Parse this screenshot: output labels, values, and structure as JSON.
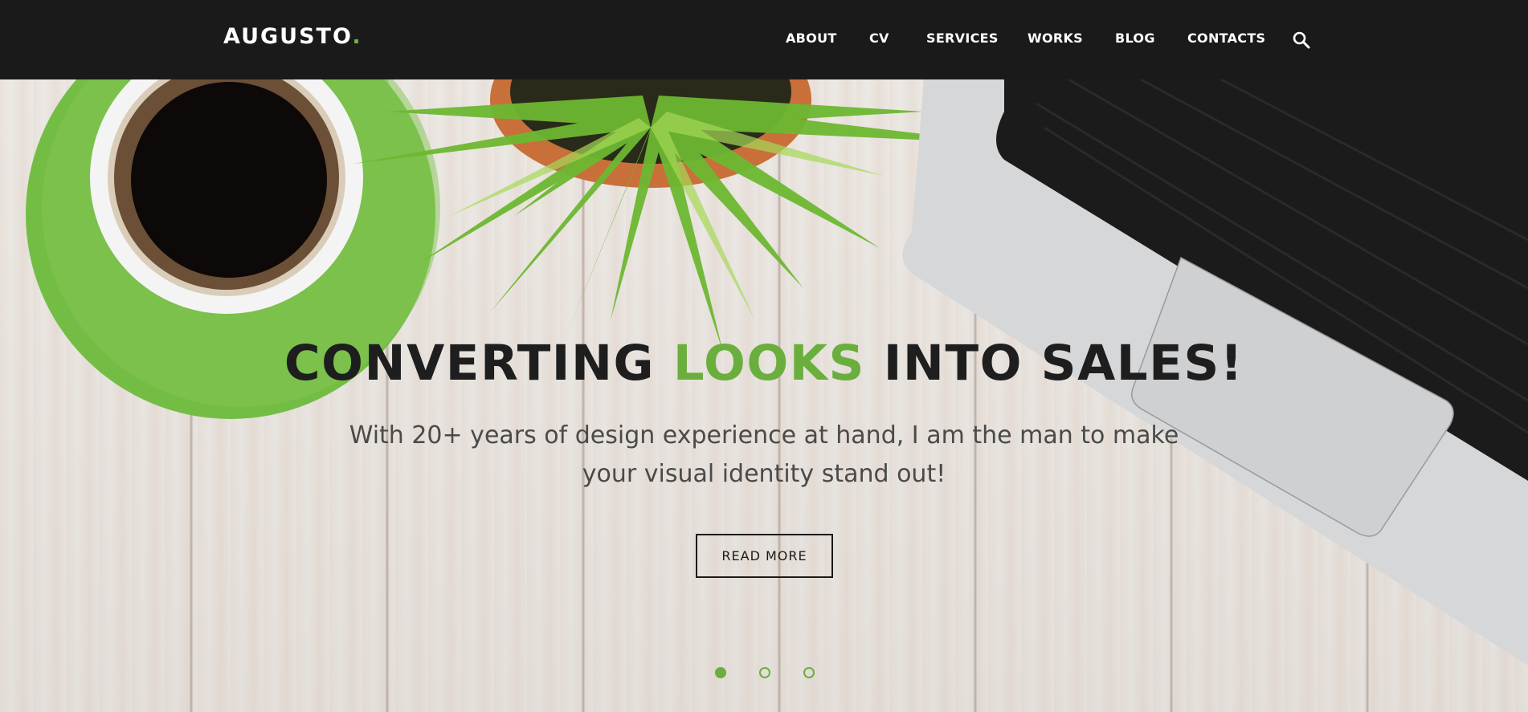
{
  "header": {
    "logo": {
      "text": "AUGUSTO",
      "dot": "."
    },
    "nav": [
      {
        "label": "ABOUT"
      },
      {
        "label": "CV"
      },
      {
        "label": "SERVICES"
      },
      {
        "label": "WORKS"
      },
      {
        "label": "BLOG"
      },
      {
        "label": "CONTACTS"
      }
    ],
    "search_icon": "search-icon"
  },
  "hero": {
    "headline": {
      "part1": "CONVERTING ",
      "accent": "LOOKS",
      "part2": " INTO SALES!"
    },
    "subtext": "With 20+ years of design experience at hand, I am the man to make your visual identity stand out!",
    "button_label": "READ MORE",
    "slider": {
      "count": 3,
      "active_index": 1
    }
  },
  "colors": {
    "header_bg": "#1a1a1a",
    "accent": "#6aaf3d",
    "text_dark": "#1e1e1e",
    "text_body": "#4a4a4a"
  }
}
